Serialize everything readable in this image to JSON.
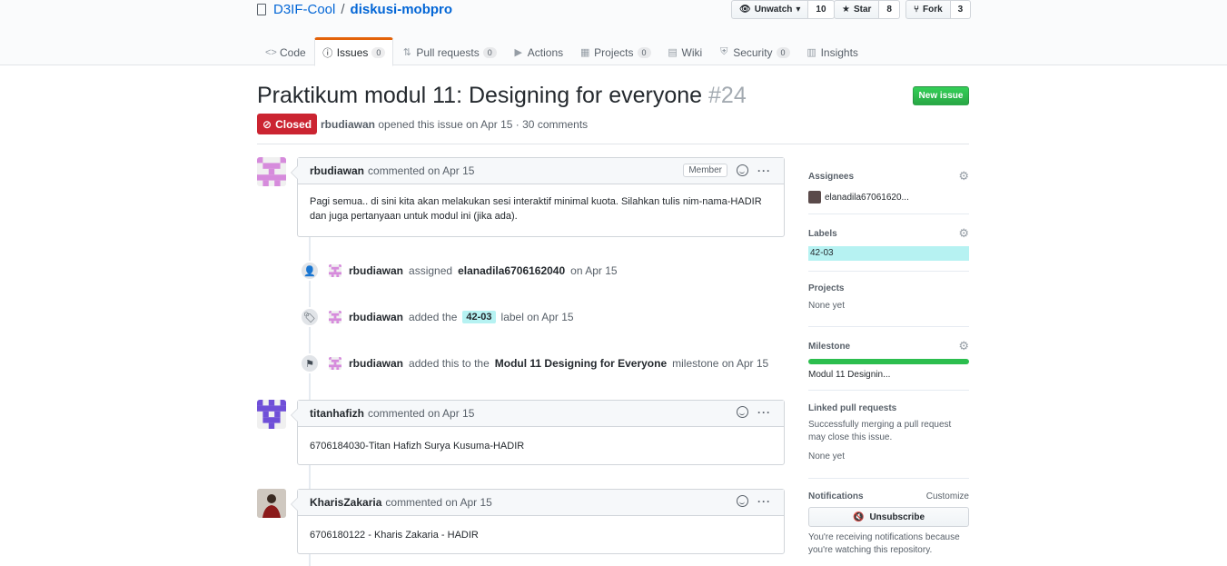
{
  "repo": {
    "owner": "D3IF-Cool",
    "name": "diskusi-mobpro"
  },
  "actions": [
    {
      "label": "Unwatch",
      "count": "10",
      "icon": "eye-icon",
      "glyph": "👁"
    },
    {
      "label": "Star",
      "count": "8",
      "icon": "star-icon",
      "glyph": "★"
    },
    {
      "label": "Fork",
      "count": "3",
      "icon": "fork-icon",
      "glyph": "⑂"
    }
  ],
  "tabs": [
    {
      "label": "Code",
      "count": null,
      "glyph": "<>"
    },
    {
      "label": "Issues",
      "count": "0",
      "glyph": "ⓘ"
    },
    {
      "label": "Pull requests",
      "count": "0",
      "glyph": "⇅"
    },
    {
      "label": "Actions",
      "count": null,
      "glyph": "▶"
    },
    {
      "label": "Projects",
      "count": "0",
      "glyph": "▦"
    },
    {
      "label": "Wiki",
      "count": null,
      "glyph": "▤"
    },
    {
      "label": "Security",
      "count": "0",
      "glyph": "⛨"
    },
    {
      "label": "Insights",
      "count": null,
      "glyph": "▥"
    }
  ],
  "issue": {
    "title": "Praktikum modul 11: Designing for everyone",
    "number": "#24",
    "state": "Closed",
    "author": "rbudiawan",
    "meta_rest": "opened this issue on Apr 15 · 30 comments",
    "new_issue": "New issue"
  },
  "comments": [
    {
      "author": "rbudiawan",
      "when": "commented on Apr 15",
      "badge": "Member",
      "body": "Pagi semua.. di sini kita akan melakukan sesi interaktif minimal kuota. Silahkan tulis nim-nama-HADIR dan juga pertanyaan untuk modul ini (jika ada)."
    },
    {
      "author": "titanhafizh",
      "when": "commented on Apr 15",
      "badge": null,
      "body": "6706184030-Titan Hafizh Surya Kusuma-HADIR"
    },
    {
      "author": "KharisZakaria",
      "when": "commented on Apr 15",
      "badge": null,
      "body": "6706180122 - Kharis Zakaria - HADIR"
    }
  ],
  "events": {
    "assigned": {
      "actor": "rbudiawan",
      "verb": "assigned",
      "target": "elanadila6706162040",
      "when": "on Apr 15"
    },
    "labeled": {
      "actor": "rbudiawan",
      "verb": "added the",
      "label": "42-03",
      "rest": "label on Apr 15"
    },
    "milestone": {
      "actor": "rbudiawan",
      "verb": "added this to the",
      "target": "Modul 11 Designing for Everyone",
      "rest": "milestone on Apr 15"
    }
  },
  "sidebar": {
    "assignees": {
      "title": "Assignees",
      "value": "elanadila67061620..."
    },
    "labels": {
      "title": "Labels",
      "value": "42-03"
    },
    "projects": {
      "title": "Projects",
      "value": "None yet"
    },
    "milestone": {
      "title": "Milestone",
      "value": "Modul 11 Designin...",
      "progress": 1.0
    },
    "linked": {
      "title": "Linked pull requests",
      "desc": "Successfully merging a pull request may close this issue.",
      "value": "None yet"
    },
    "notifications": {
      "title": "Notifications",
      "customize": "Customize",
      "button": "Unsubscribe",
      "desc": "You're receiving notifications because you're watching this repository."
    }
  },
  "colors": {
    "closed": "#cb2431",
    "new_issue": "#28a745",
    "label_bg": "#b6f2f2",
    "link": "#0366d6"
  }
}
